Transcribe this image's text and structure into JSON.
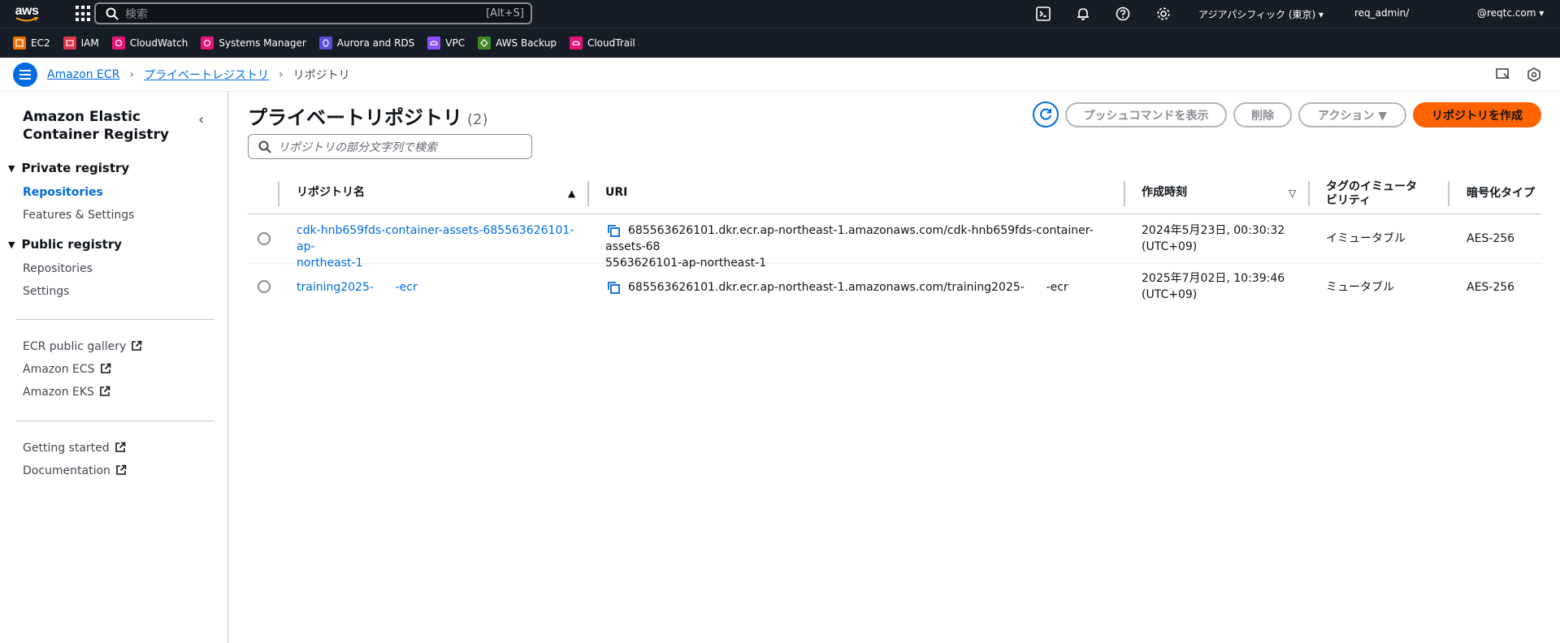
{
  "topbar": {
    "logo_text": "aws",
    "search_placeholder": "検索",
    "search_shortcut": "[Alt+S]",
    "region": "アジアパシフィック (東京) ▾",
    "user": "req_admin/",
    "account": "@reqtc.com ▾"
  },
  "favorites": [
    {
      "label": "EC2",
      "color": "#ed7100"
    },
    {
      "label": "IAM",
      "color": "#dd344c"
    },
    {
      "label": "CloudWatch",
      "color": "#e7157b"
    },
    {
      "label": "Systems Manager",
      "color": "#e7157b"
    },
    {
      "label": "Aurora and RDS",
      "color": "#5c4ddb"
    },
    {
      "label": "VPC",
      "color": "#8c4fff"
    },
    {
      "label": "AWS Backup",
      "color": "#3f8624"
    },
    {
      "label": "CloudTrail",
      "color": "#e7157b"
    }
  ],
  "breadcrumb": {
    "items": [
      "Amazon ECR",
      "プライベートレジストリ",
      "リポジトリ"
    ]
  },
  "sidebar": {
    "title": "Amazon Elastic Container Registry",
    "private_section": "Private registry",
    "private_items": [
      "Repositories",
      "Features & Settings"
    ],
    "public_section": "Public registry",
    "public_items": [
      "Repositories",
      "Settings"
    ],
    "links": [
      "ECR public gallery",
      "Amazon ECS",
      "Amazon EKS"
    ],
    "links2": [
      "Getting started",
      "Documentation"
    ]
  },
  "main": {
    "title": "プライベートリポジトリ",
    "count": "(2)",
    "buttons": {
      "push": "プッシュコマンドを表示",
      "delete": "削除",
      "actions": "アクション ▼",
      "create": "リポジトリを作成"
    },
    "filter_placeholder": "リポジトリの部分文字列で検索",
    "columns": [
      "リポジトリ名",
      "URI",
      "作成時刻",
      "タグのイミュータビリティ",
      "暗号化タイプ"
    ],
    "rows": [
      {
        "name_line1": "cdk-hnb659fds-container-assets-685563626101-ap-",
        "name_line2": "northeast-1",
        "uri_line1": "685563626101.dkr.ecr.ap-northeast-1.amazonaws.com/cdk-hnb659fds-container-assets-68",
        "uri_line2": "5563626101-ap-northeast-1",
        "created_line1": "2024年5月23日, 00:30:32",
        "created_line2": "(UTC+09)",
        "mutability": "イミュータブル",
        "encryption": "AES-256"
      },
      {
        "name_line1": "training2025-      -ecr",
        "uri_line1": "685563626101.dkr.ecr.ap-northeast-1.amazonaws.com/training2025-      -ecr",
        "created_line1": "2025年7月02日, 10:39:46",
        "created_line2": "(UTC+09)",
        "mutability": "ミュータブル",
        "encryption": "AES-256"
      }
    ]
  }
}
